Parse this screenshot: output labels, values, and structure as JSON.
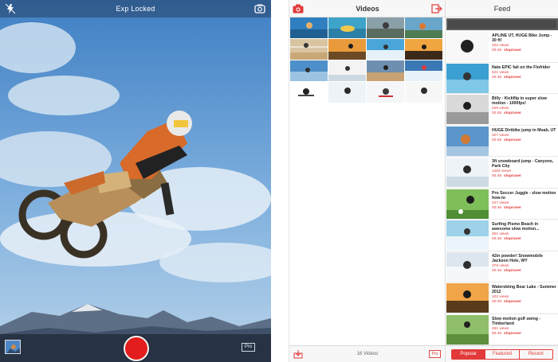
{
  "camera": {
    "status_text": "Exp Locked",
    "pro_label": "Pro",
    "icons": [
      "flash-icon",
      "camera-switch-icon",
      "record-icon"
    ],
    "record_color": "#e31d1d"
  },
  "videos": {
    "title": "Videos",
    "count_label": "16 Videos",
    "pro_label": "Pro",
    "icons": [
      "camera-icon",
      "export-icon",
      "import-icon"
    ]
  },
  "feed": {
    "title": "Feed",
    "search_placeholder": "",
    "items": [
      {
        "title": "APLINE UT, HUGE Bike Jump - 30 ft!",
        "views": "102 views",
        "duration": "00:48",
        "user": "slopruser"
      },
      {
        "title": "Nate EPIC fail on the Flofrider",
        "views": "621 views",
        "duration": "00:48",
        "user": "slopruser"
      },
      {
        "title": "Billy - Kickflip in super slow motion - 1000fps!",
        "views": "428 views",
        "duration": "00:48",
        "user": "slopruser"
      },
      {
        "title": "HUGE Dirtbike jump in Moab, UT",
        "views": "327 views",
        "duration": "00:48",
        "user": "slopruser"
      },
      {
        "title": "3ft snowboard jump - Canyons, Park City",
        "views": "1483 views",
        "duration": "00:48",
        "user": "slopruser"
      },
      {
        "title": "Pro Soccer Juggle - slow motion how-to",
        "views": "247 views",
        "duration": "00:48",
        "user": "slopruser"
      },
      {
        "title": "Surfing Pismo Beach in awesome slow motion...",
        "views": "301 views",
        "duration": "00:48",
        "user": "slopruser"
      },
      {
        "title": "42in powder! Snowmobile Jackson Hole, WY",
        "views": "378 views",
        "duration": "00:48",
        "user": "slopruser"
      },
      {
        "title": "Waterskiing Bear Lake - Summer 2012",
        "views": "102 views",
        "duration": "00:48",
        "user": "slopruser"
      },
      {
        "title": "Slow motion golf swing - Timberland",
        "views": "481 views",
        "duration": "00:48",
        "user": "slopruser"
      }
    ],
    "tabs": [
      "Popular",
      "Featured",
      "Recent"
    ],
    "active_tab": "Popular",
    "accent_color": "#e23a3a"
  }
}
